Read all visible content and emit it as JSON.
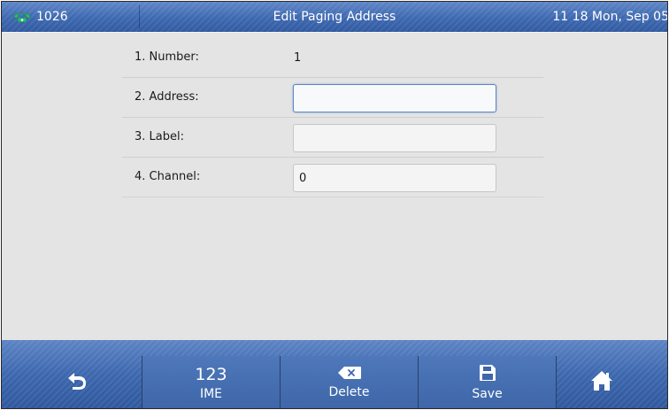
{
  "topbar": {
    "account": "1026",
    "title": "Edit Paging Address",
    "datetime": "11 18 Mon, Sep 05"
  },
  "form": {
    "rows": [
      {
        "label": "1. Number:",
        "value": "1"
      },
      {
        "label": "2. Address:",
        "value": ""
      },
      {
        "label": "3. Label:",
        "value": ""
      },
      {
        "label": "4. Channel:",
        "value": "0"
      }
    ]
  },
  "softkeys": {
    "ime_mode": "123",
    "ime_label": "IME",
    "delete_label": "Delete",
    "save_label": "Save"
  },
  "icons": {
    "account": "phone-icon",
    "back": "back-arrow-icon",
    "delete": "backspace-icon",
    "save": "floppy-disk-icon",
    "home": "home-icon"
  },
  "colors": {
    "bar_blue": "#3d68b0",
    "phone_green": "#2fb37a",
    "content_bg": "#e4e4e4",
    "active_field_border": "#5b87c6"
  }
}
